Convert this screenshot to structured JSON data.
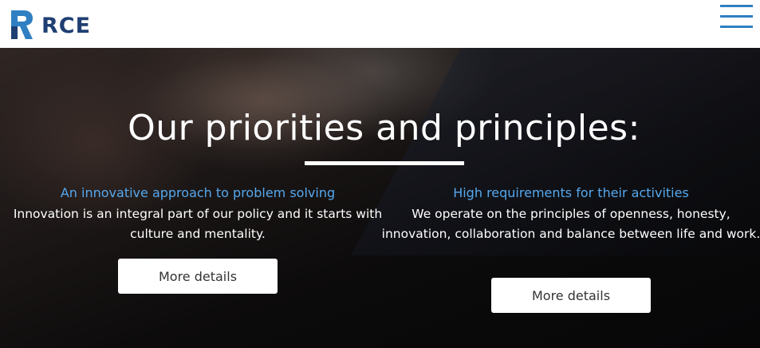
{
  "header": {
    "logo_text": "RCE",
    "menu_icon": "hamburger-menu-icon"
  },
  "hero": {
    "title": "Our priorities and principles:",
    "columns": [
      {
        "heading": "An innovative approach to problem solving",
        "text": "Innovation is an integral part of our policy and it starts with culture and mentality.",
        "button_label": "More details"
      },
      {
        "heading": "High requirements for their activities",
        "text": "We operate on the principles of openness, honesty, innovation, collaboration and balance between life and work.",
        "button_label": "More details"
      }
    ]
  },
  "colors": {
    "brand_dark": "#1f3f73",
    "brand_accent": "#2f7fc2",
    "heading_blue": "#55a8ee"
  }
}
